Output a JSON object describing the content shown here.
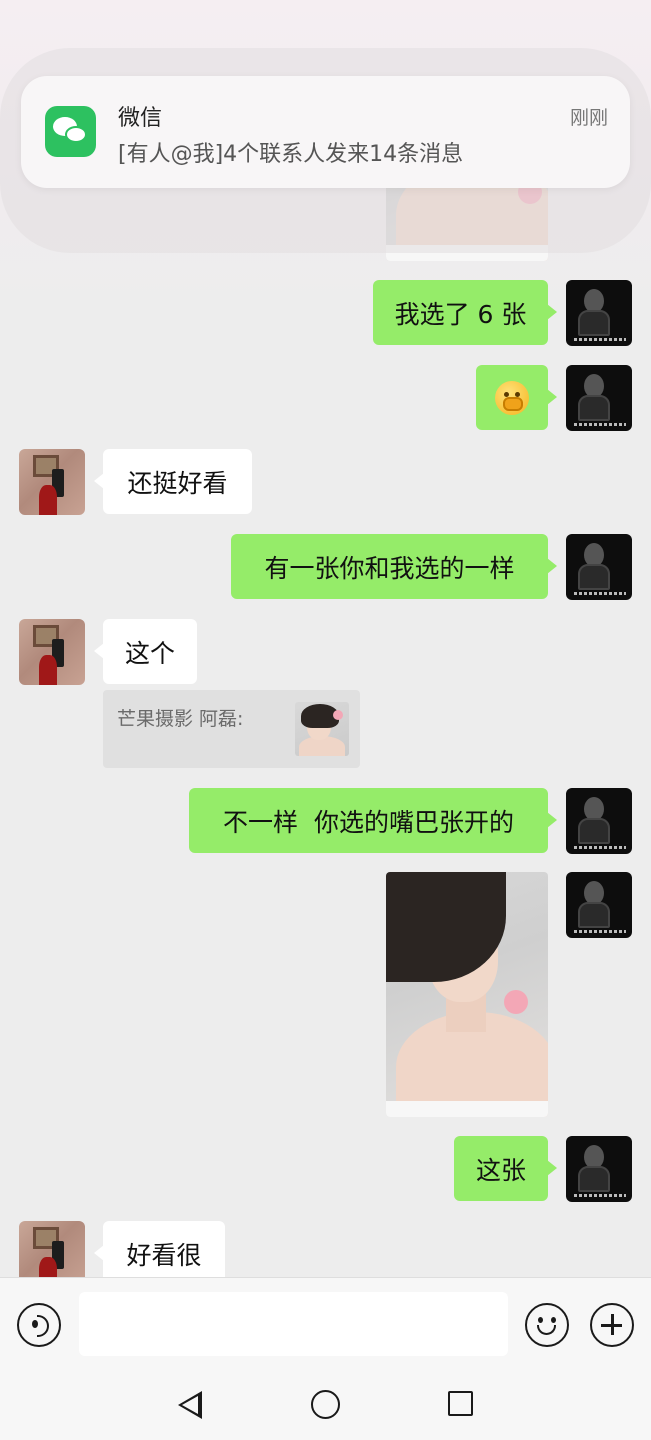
{
  "notification": {
    "app_name": "微信",
    "message": "[有人@我]4个联系人发来14条消息",
    "time": "刚刚",
    "icon": "wechat-icon"
  },
  "messages": [
    {
      "id": "m1",
      "side": "me",
      "type": "image",
      "desc": "photo"
    },
    {
      "id": "m2",
      "side": "me",
      "type": "text",
      "text": "我选了 6 张"
    },
    {
      "id": "m3",
      "side": "me",
      "type": "emoji",
      "icon": "thinking-face-emoji"
    },
    {
      "id": "m4",
      "side": "other",
      "type": "text",
      "text": "还挺好看"
    },
    {
      "id": "m5",
      "side": "me",
      "type": "text",
      "text": "有一张你和我选的一样"
    },
    {
      "id": "m6",
      "side": "other",
      "type": "text",
      "text": "这个",
      "quote": {
        "text": "芒果摄影  阿磊:",
        "type": "image"
      }
    },
    {
      "id": "m7",
      "side": "me",
      "type": "text",
      "text": "不一样  你选的嘴巴张开的"
    },
    {
      "id": "m8",
      "side": "me",
      "type": "image",
      "desc": "photo"
    },
    {
      "id": "m9",
      "side": "me",
      "type": "text",
      "text": "这张"
    },
    {
      "id": "m10",
      "side": "other",
      "type": "text",
      "text": "好看很"
    }
  ],
  "input_bar": {
    "placeholder": "",
    "icons": [
      "voice-icon",
      "emoji-icon",
      "plus-icon"
    ]
  },
  "nav_bar": {
    "icons": [
      "back-icon",
      "home-icon",
      "recents-icon"
    ]
  },
  "colors": {
    "background": "#ededed",
    "my_bubble": "#95ec69",
    "other_bubble": "#ffffff",
    "wechat_green": "#2dc160"
  }
}
